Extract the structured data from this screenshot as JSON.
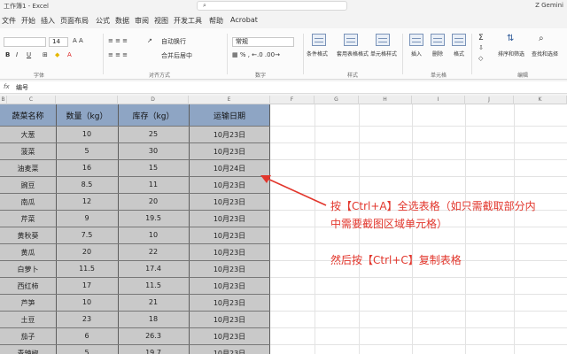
{
  "titlebar": {
    "title": "工作簿1 - Excel",
    "user": "Z Gemini"
  },
  "menu": {
    "tabs": [
      "文件",
      "开始",
      "插入",
      "页面布局",
      "公式",
      "数据",
      "审阅",
      "视图",
      "开发工具",
      "帮助",
      "Acrobat"
    ]
  },
  "ribbon": {
    "font_size": "14",
    "wrap_text": "自动换行",
    "merge_center": "合并后居中",
    "number_format": "常规",
    "cond_format": "条件格式",
    "table_format": "套用表格格式",
    "cell_styles": "单元格样式",
    "insert": "插入",
    "delete": "删除",
    "format": "格式",
    "sort_filter": "排序和筛选",
    "find_select": "查找和选择",
    "groups": [
      "字体",
      "对齐方式",
      "数字",
      "样式",
      "单元格",
      "编辑"
    ]
  },
  "formula_bar": {
    "fx": "fx",
    "content": "编号"
  },
  "columns": [
    "B",
    "C",
    "D",
    "E",
    "F",
    "G",
    "H",
    "I",
    "J",
    "K"
  ],
  "table": {
    "headers": [
      "蔬菜名称",
      "数量（kg）",
      "库存（kg）",
      "运输日期"
    ],
    "rows": [
      [
        "大葱",
        "10",
        "25",
        "10月23日"
      ],
      [
        "菠菜",
        "5",
        "30",
        "10月23日"
      ],
      [
        "油麦菜",
        "16",
        "15",
        "10月24日"
      ],
      [
        "豌豆",
        "8.5",
        "11",
        "10月23日"
      ],
      [
        "南瓜",
        "12",
        "20",
        "10月23日"
      ],
      [
        "芹菜",
        "9",
        "19.5",
        "10月23日"
      ],
      [
        "黄秋葵",
        "7.5",
        "10",
        "10月23日"
      ],
      [
        "黄瓜",
        "20",
        "22",
        "10月23日"
      ],
      [
        "白萝卜",
        "11.5",
        "17.4",
        "10月23日"
      ],
      [
        "西红柿",
        "17",
        "11.5",
        "10月23日"
      ],
      [
        "芦笋",
        "10",
        "21",
        "10月23日"
      ],
      [
        "土豆",
        "23",
        "18",
        "10月23日"
      ],
      [
        "茄子",
        "6",
        "26.3",
        "10月23日"
      ],
      [
        "青辣椒",
        "5",
        "19.7",
        "10月23日"
      ]
    ]
  },
  "annotation": {
    "line1": "按【Ctrl+A】全选表格（如只需截取部分内",
    "line2": "中需要截图区域单元格）",
    "line3": "然后按【Ctrl+C】复制表格",
    "color": "#e2362c"
  }
}
